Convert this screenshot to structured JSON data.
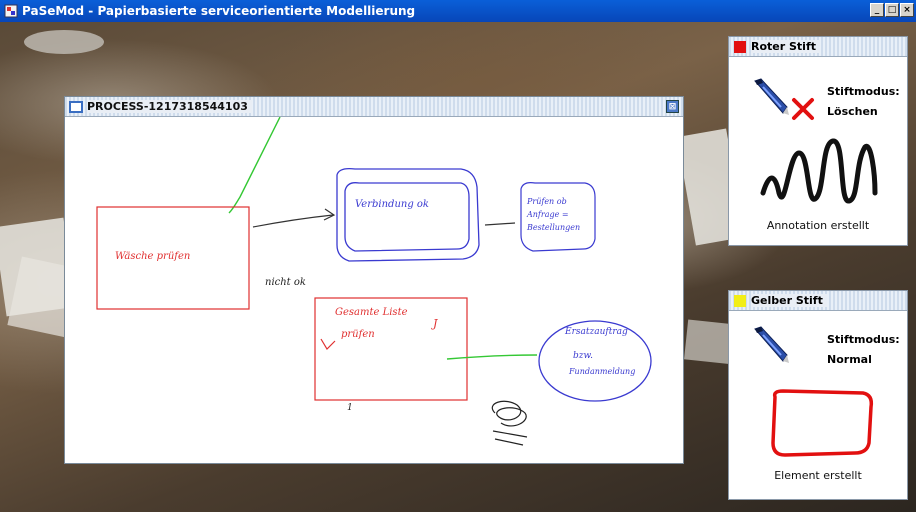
{
  "window": {
    "title": "PaSeMod - Papierbasierte serviceorientierte Modellierung",
    "controls": [
      "_",
      "□",
      "×"
    ]
  },
  "process_window": {
    "title": "PROCESS-1217318544103",
    "close": "⊠",
    "handwriting": {
      "box1": "Wäsche prüfen",
      "box2": "Verbindung ok",
      "box3": "Prüfen ob Anfrage = Bestellungen",
      "label_nicht_ok": "nicht ok",
      "box4_line1": "Gesamte Liste",
      "box4_line2": "prüfen",
      "box4_mark": "J",
      "ellipse_line1": "Ersatzauftrag",
      "ellipse_line2": "bzw.",
      "ellipse_line3": "Fundanmeldung",
      "small_mark": "1"
    }
  },
  "red_pen_panel": {
    "title": "Roter Stift",
    "swatch_color": "#e21010",
    "mode_heading": "Stiftmodus:",
    "mode_value": "Löschen",
    "status": "Annotation erstellt"
  },
  "yellow_pen_panel": {
    "title": "Gelber Stift",
    "swatch_color": "#f2ee18",
    "mode_heading": "Stiftmodus:",
    "mode_value": "Normal",
    "status": "Element erstellt"
  },
  "colors": {
    "titlebar": "#0a5fd8",
    "ink_red": "#e03030",
    "ink_blue": "#3a3ad0",
    "ink_green": "#35c835",
    "ink_black": "#222222"
  }
}
